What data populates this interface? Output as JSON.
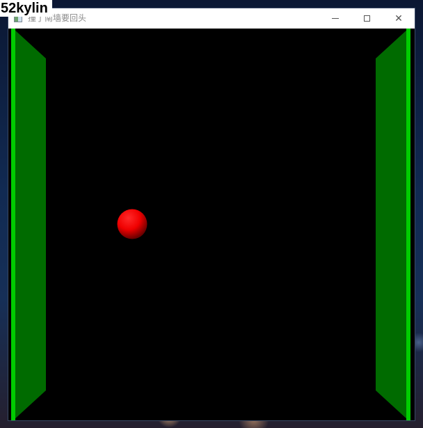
{
  "watermark": {
    "text": "52kylin"
  },
  "window": {
    "title": "撞了南墙要回头",
    "app_icon": "window-app-icon",
    "controls": {
      "minimize_icon": "minimize-icon",
      "maximize_icon": "maximize-icon",
      "close_icon": "close-icon",
      "close_glyph": "✕"
    }
  },
  "scene": {
    "background_color": "#000000",
    "left_wall": {
      "color": "#006b00",
      "edge_color": "#00cc00"
    },
    "right_wall": {
      "color": "#006b00",
      "edge_color": "#00cc00"
    },
    "ball": {
      "color": "#ff0000",
      "shade_color": "#6a0000"
    }
  }
}
